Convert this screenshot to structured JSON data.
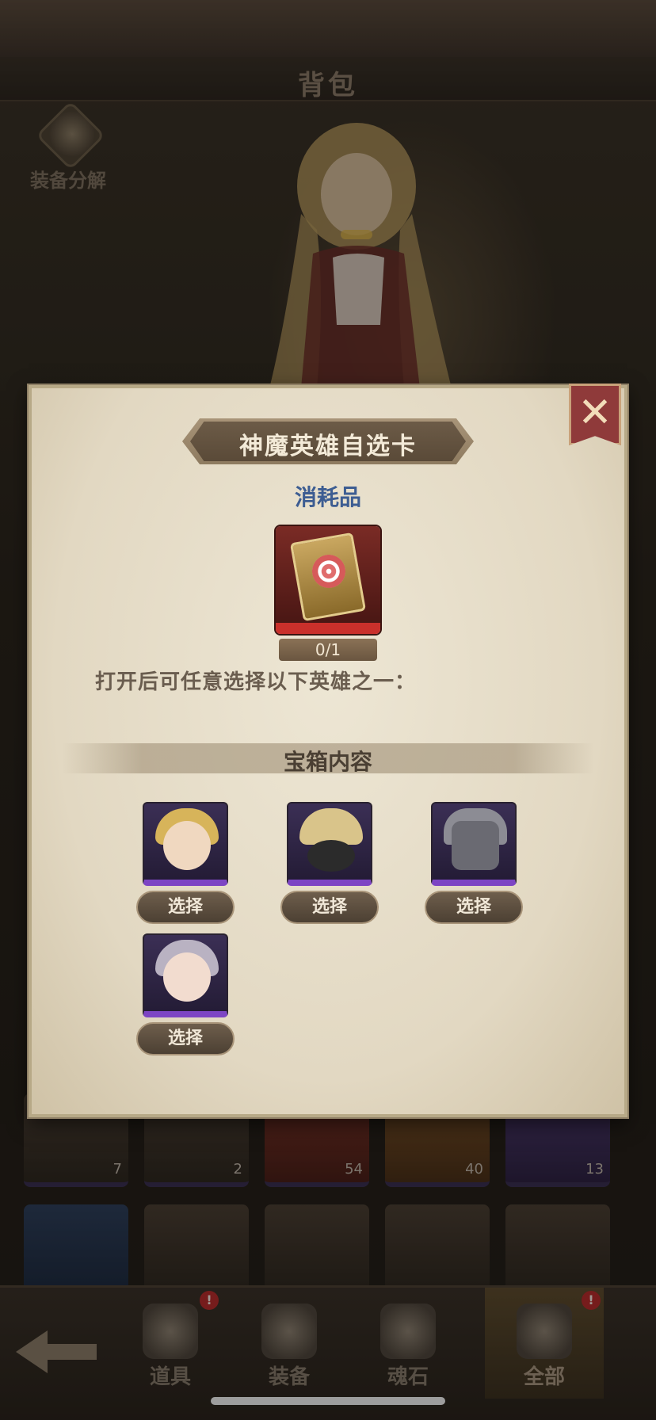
{
  "header": {
    "title": "背包"
  },
  "salvage": {
    "label": "装备分解",
    "icon": "salvage-icon"
  },
  "inventory_counts": [
    "7",
    "2",
    "54",
    "40",
    "13"
  ],
  "nav": {
    "back_icon": "back-arrow-icon",
    "tabs": [
      {
        "label": "道具",
        "badge": "!",
        "icon": "scroll-icon",
        "active": false
      },
      {
        "label": "装备",
        "badge": "",
        "icon": "armor-icon",
        "active": false
      },
      {
        "label": "魂石",
        "badge": "",
        "icon": "crystal-icon",
        "active": false
      },
      {
        "label": "全部",
        "badge": "!",
        "icon": "book-icon",
        "active": true
      }
    ]
  },
  "dialog": {
    "title": "神魔英雄自选卡",
    "close_icon": "close-icon",
    "item_type": "消耗品",
    "item_icon": "hero-card-icon",
    "count": "0/1",
    "description": "打开后可任意选择以下英雄之一：",
    "section_title": "宝箱内容",
    "heroes": [
      {
        "select_label": "选择",
        "portrait": "blonde-heroine"
      },
      {
        "select_label": "选择",
        "portrait": "masked-swordsman"
      },
      {
        "select_label": "选择",
        "portrait": "horned-knight"
      },
      {
        "select_label": "选择",
        "portrait": "demon-girl"
      }
    ]
  },
  "colors": {
    "accent_blue": "#3d5d92",
    "close_red": "#8f3a3a",
    "badge_red": "#b52b2b",
    "rarity_purple": "#7d45c4"
  }
}
